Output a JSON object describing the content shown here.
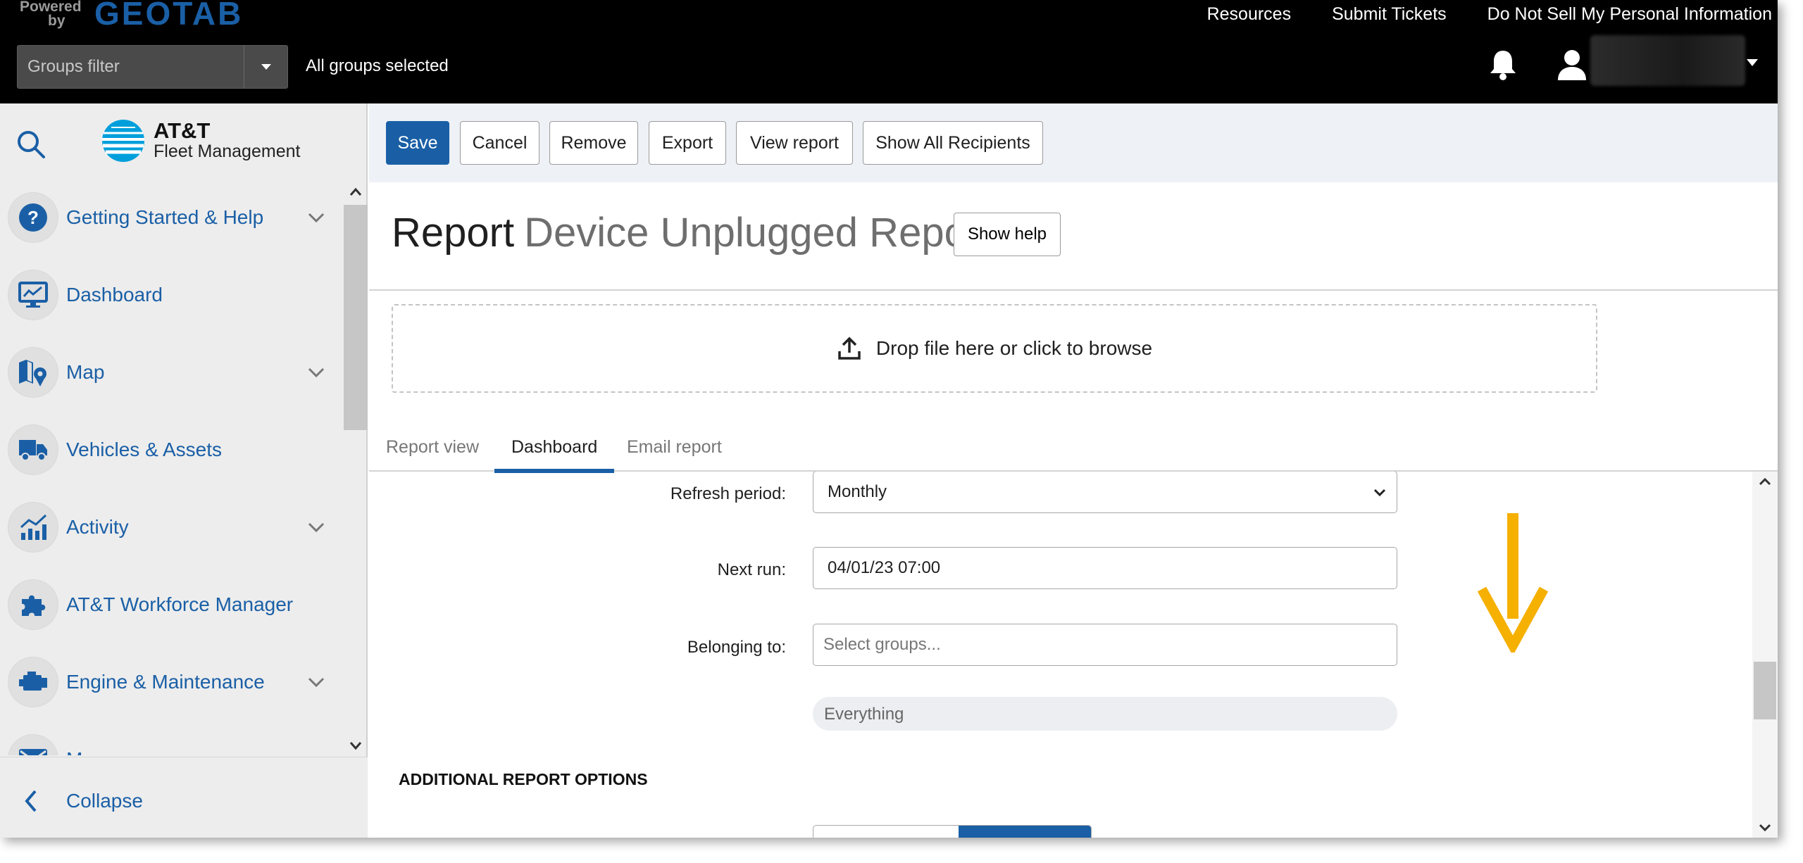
{
  "header": {
    "powered_line1": "Powered",
    "powered_line2": "by",
    "logo_text": "GEOTAB",
    "links": [
      "Resources",
      "Submit Tickets",
      "Do Not Sell My Personal Information"
    ],
    "groups_filter_placeholder": "Groups filter",
    "groups_status": "All groups selected",
    "icons": [
      "bell-icon",
      "user-icon",
      "caret-down-icon"
    ]
  },
  "sidebar": {
    "brand_line1": "AT&T",
    "brand_line2": "Fleet Management",
    "items": [
      {
        "label": "Getting Started & Help",
        "icon": "help-icon",
        "expandable": true
      },
      {
        "label": "Dashboard",
        "icon": "dashboard-icon",
        "expandable": false
      },
      {
        "label": "Map",
        "icon": "map-icon",
        "expandable": true
      },
      {
        "label": "Vehicles & Assets",
        "icon": "truck-icon",
        "expandable": false
      },
      {
        "label": "Activity",
        "icon": "activity-chart-icon",
        "expandable": true
      },
      {
        "label": "AT&T Workforce Manager",
        "icon": "puzzle-icon",
        "expandable": false
      },
      {
        "label": "Engine & Maintenance",
        "icon": "engine-icon",
        "expandable": true
      },
      {
        "label": "M",
        "icon": "mail-icon",
        "expandable": false
      }
    ],
    "collapse_label": "Collapse"
  },
  "toolbar": {
    "save": "Save",
    "cancel": "Cancel",
    "remove": "Remove",
    "export": "Export",
    "view_report": "View report",
    "show_all_recipients": "Show All Recipients"
  },
  "page": {
    "title_prefix": "Report",
    "title_name": "Device Unplugged Report",
    "show_help": "Show help",
    "dropzone_text": "Drop file here or click to browse"
  },
  "tabs": [
    {
      "label": "Report view",
      "active": false
    },
    {
      "label": "Dashboard",
      "active": true
    },
    {
      "label": "Email report",
      "active": false
    }
  ],
  "form": {
    "refresh_label": "Refresh period:",
    "refresh_value": "Monthly",
    "next_run_label": "Next run:",
    "next_run_value": "04/01/23 07:00",
    "belonging_label": "Belonging to:",
    "belonging_placeholder": "Select groups...",
    "belonging_chip": "Everything",
    "additional_heading": "ADDITIONAL REPORT OPTIONS"
  },
  "colors": {
    "accent": "#1a5fa6",
    "annotation_arrow": "#f5b000",
    "header_bg": "#000000",
    "sidebar_bg": "#ededed"
  }
}
